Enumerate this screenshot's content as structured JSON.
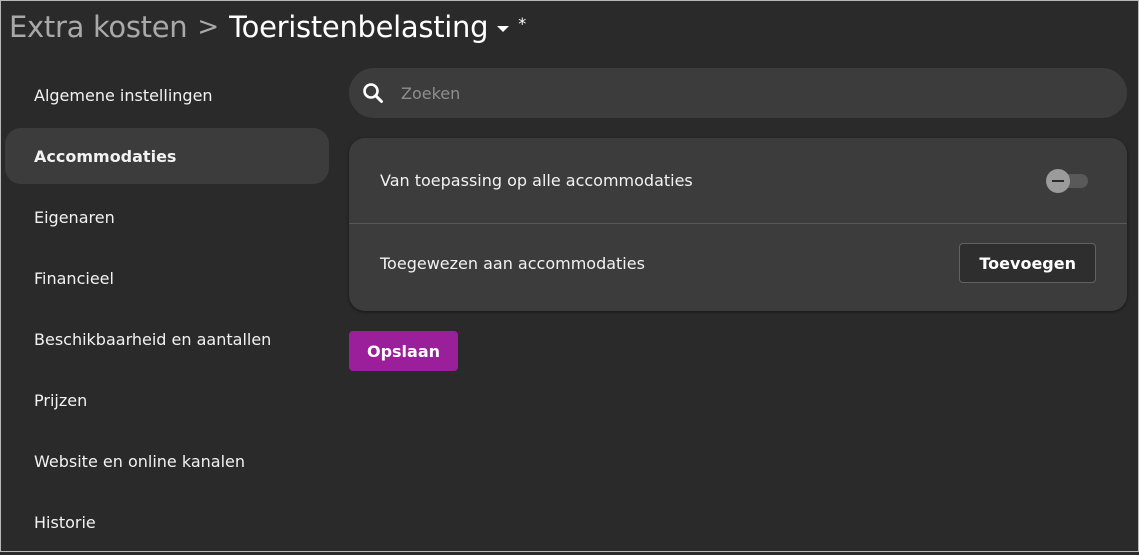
{
  "header": {
    "parent": "Extra kosten",
    "separator": ">",
    "current": "Toeristenbelasting",
    "unsaved_marker": "*"
  },
  "sidebar": {
    "items": [
      {
        "label": "Algemene instellingen",
        "active": false
      },
      {
        "label": "Accommodaties",
        "active": true
      },
      {
        "label": "Eigenaren",
        "active": false
      },
      {
        "label": "Financieel",
        "active": false
      },
      {
        "label": "Beschikbaarheid en aantallen",
        "active": false
      },
      {
        "label": "Prijzen",
        "active": false
      },
      {
        "label": "Website en online kanalen",
        "active": false
      },
      {
        "label": "Historie",
        "active": false
      }
    ]
  },
  "search": {
    "placeholder": "Zoeken",
    "value": "",
    "icon": "search-icon"
  },
  "card": {
    "apply_all_label": "Van toepassing op alle accommodaties",
    "apply_all_enabled": false,
    "assigned_label": "Toegewezen aan accommodaties",
    "add_label": "Toevoegen"
  },
  "actions": {
    "save_label": "Opslaan"
  },
  "colors": {
    "background": "#2b2a2b",
    "surface": "#3d3c3d",
    "accent": "#9b1e9a",
    "muted_text": "#a9a9a9"
  }
}
